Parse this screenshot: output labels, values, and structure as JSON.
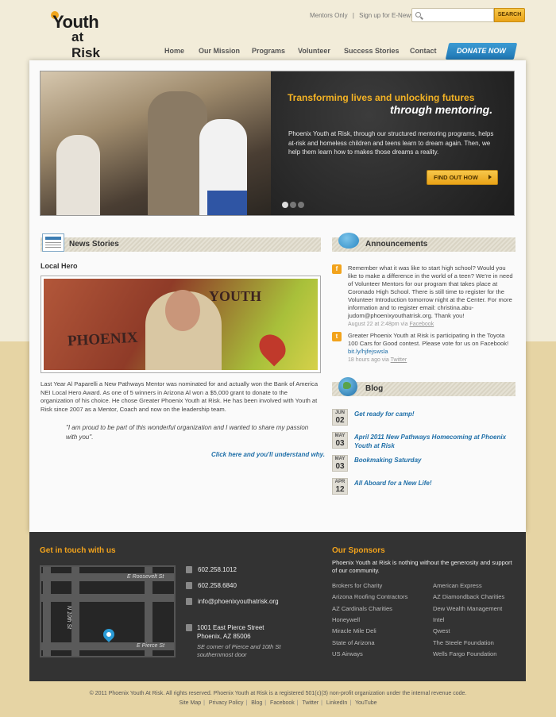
{
  "header": {
    "logo": {
      "youth": "Youth",
      "at_risk": "at Risk"
    },
    "toplinks": [
      "Mentors Only",
      "Sign up for E-News"
    ],
    "search": {
      "placeholder": "",
      "button": "SEARCH"
    },
    "nav": [
      "Home",
      "Our Mission",
      "Programs",
      "Volunteer",
      "Success Stories",
      "Contact"
    ],
    "donate": "DONATE NOW"
  },
  "hero": {
    "headline1": "Transforming lives and unlocking futures",
    "headline2": "through mentoring.",
    "body": "Phoenix Youth at Risk, through our structured mentoring programs, helps at-risk and homeless children and teens learn to dream again. Then, we help them learn how to makes those dreams a reality.",
    "button": "FIND OUT HOW",
    "slides": 3,
    "active_slide": 1
  },
  "news": {
    "section_title": "News Stories",
    "story_title": "Local Hero",
    "image_text": {
      "phoenix": "PHOENIX",
      "youth": "YOUTH"
    },
    "body": "Last Year Al Paparelli a New Pathways Mentor was nominated for and actually won the Bank of America NEI Local Hero Award. As one of 5 winners in Arizona Al won a $5,000 grant to donate to the organization of his choice. He chose Greater Phoenix Youth at Risk. He has been involved with Youth at Risk since 2007 as a Mentor, Coach and now on the leadership team.",
    "quote": "\"I am proud to be part of this wonderful organization and I wanted to share my passion with you\".",
    "link": "Click here and you'll understand why."
  },
  "announcements": {
    "section_title": "Announcements",
    "items": [
      {
        "icon": "facebook-icon",
        "text": "Remember what it was like to start high school? Would you like to make a difference in the world of a teen? We're in need of Volunteer Mentors for our program that takes place at Coronado High School. There is still time to register for the Volunteer Introduction tomorrow night at the Center. For more information and to register email: christina.abu-judom@phoenixyouthatrisk.org. Thank you!",
        "meta": "August 22 at 2:48pm via",
        "via": "Facebook"
      },
      {
        "icon": "twitter-icon",
        "text": "Greater Phoenix Youth at Risk is participating in the Toyota 100 Cars for Good contest. Please vote for us on Facebook!",
        "link": "bit.ly/hjfejswsla",
        "meta": "18 hours ago via",
        "via": "Twitter"
      }
    ]
  },
  "blog": {
    "section_title": "Blog",
    "posts": [
      {
        "month": "JUN",
        "day": "02",
        "title": "Get ready for camp!"
      },
      {
        "month": "MAY",
        "day": "03",
        "title": "April 2011 New Pathways Homecoming at Phoenix Youth at Risk"
      },
      {
        "month": "MAY",
        "day": "03",
        "title": "Bookmaking Saturday"
      },
      {
        "month": "APR",
        "day": "12",
        "title": "All Aboard for a New Life!"
      }
    ]
  },
  "footer": {
    "contact_title": "Get in touch with us",
    "map_labels": {
      "roosevelt": "E Roosevelt St",
      "pierce": "E Pierce St",
      "tenth": "N 10th St"
    },
    "phone": "602.258.1012",
    "fax": "602.258.6840",
    "email": "info@phoenixyouthatrisk.org",
    "address1": "1001 East Pierce Street",
    "address2": "Phoenix, AZ  85006",
    "address_note": "SE corner of Pierce and 10th St southernmost door",
    "sponsors_title": "Our Sponsors",
    "sponsors_intro": "Phoenix Youth at Risk is nothing without the generosity and support of our community.",
    "sponsors_left": [
      "Brokers for Charity",
      "Arizona Roofing Contractors",
      "AZ Cardinals Charities",
      "Honeywell",
      "Miracle Mile Deli",
      "State of Arizona",
      "US Airways"
    ],
    "sponsors_right": [
      "American Express",
      "AZ Diamondback Charities",
      "Dew Wealth Management",
      "Intel",
      "Qwest",
      "The Steele Foundation",
      "Wells Fargo Foundation"
    ]
  },
  "bottom": {
    "copyright": "© 2011 Phoenix Youth At Risk. All rights reserved. Phoenix Youth at Risk is a registered 501(c)(3) non-profit organization under the internal revenue code.",
    "links": [
      "Site Map",
      "Privacy Policy",
      "Blog",
      "Facebook",
      "Twitter",
      "LinkedIn",
      "YouTube"
    ]
  },
  "colors": {
    "accent": "#f2a31c",
    "link": "#1f6fa8",
    "donate": "#1f77b4",
    "footer_bg": "#333333"
  }
}
